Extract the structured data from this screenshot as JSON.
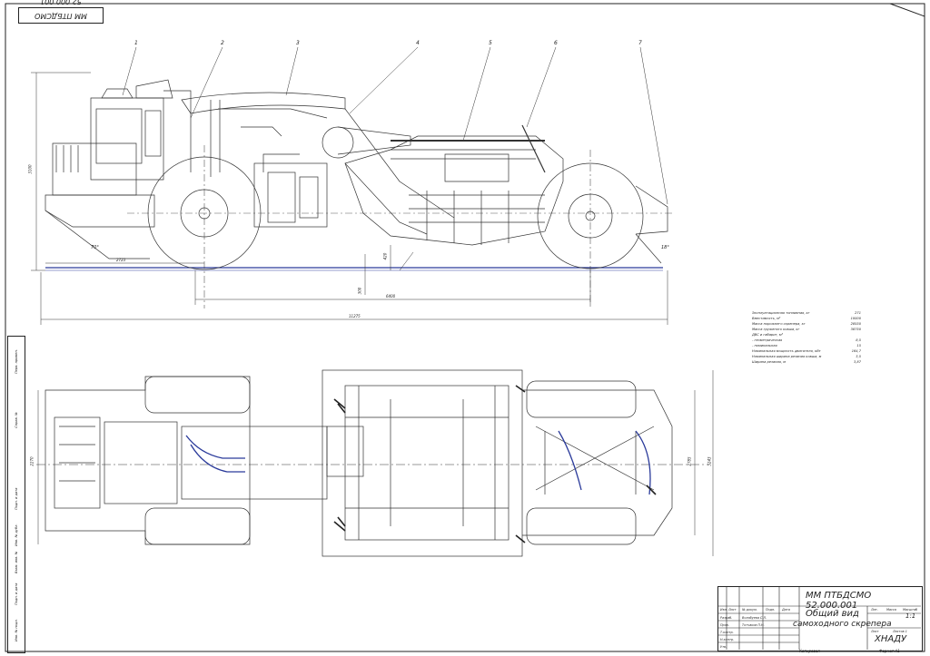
{
  "stamp_top": "ММ ПТБДСМО 52.000.001",
  "leaders": [
    "1",
    "2",
    "3",
    "4",
    "5",
    "6",
    "7"
  ],
  "dims": {
    "d2723": "2723",
    "d6400": "6400",
    "d11275": "11275",
    "d3100": "3100",
    "d2270": "2270",
    "d2785": "2785",
    "d3243": "3243",
    "d300": "300",
    "d420": "420",
    "a1": "70°",
    "a2": "18°"
  },
  "specs": [
    {
      "label": "Эксплуатационная топливная, кг",
      "value": "271"
    },
    {
      "label": "Вместимость, м³",
      "value": "10000"
    },
    {
      "label": "Масса порожнего скрепера, кг",
      "value": "28550"
    },
    {
      "label": "Масса груженого ковша, кг",
      "value": "38750"
    },
    {
      "label": "ДВС и габарит, м³",
      "value": ""
    },
    {
      "label": "- геометрическая",
      "value": "8,5"
    },
    {
      "label": "- номинальная",
      "value": "15"
    },
    {
      "label": "Номинальная мощность двигателя, кВт",
      "value": "164,7"
    },
    {
      "label": "Номинальная ширина резания ковша, м",
      "value": "3,5"
    },
    {
      "label": "Ширина резания, м",
      "value": "3,87"
    }
  ],
  "title_block": {
    "code": "ММ ПТБДСМО 52.000.001",
    "name_line1": "Общий вид",
    "name_line2": "самоходного скрепера",
    "sheet_count": "1:1",
    "org": "ХНАДУ",
    "col_labels": [
      "Изм.",
      "Лист",
      "№ докум.",
      "Подп.",
      "Дата"
    ],
    "role_labels": [
      "Разраб.",
      "Пров.",
      "Т.контр.",
      "Н.контр.",
      "Утв."
    ],
    "names": [
      "Волобуева С.Л.",
      "Тотчаков П.Н."
    ],
    "lit_labels": [
      "Лит.",
      "Масса",
      "Масштаб"
    ],
    "sheet_labels": [
      "Лист",
      "Листов 1"
    ],
    "footer_copy": "Копировал",
    "footer_format": "Формат A1"
  },
  "left_strip": [
    "Перв. примен.",
    "Справ. №",
    "Подп. и дата",
    "Инв. № дубл.",
    "Взам. инв. №",
    "Подп. и дата",
    "Инв. № подл."
  ]
}
